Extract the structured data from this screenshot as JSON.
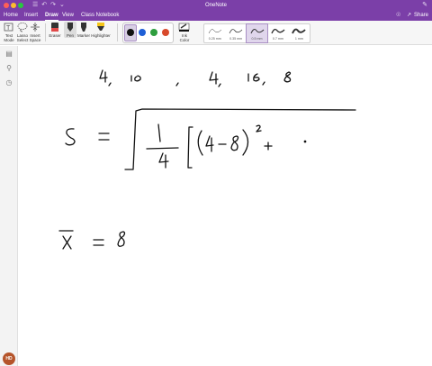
{
  "window": {
    "title": "OneNote"
  },
  "menu": {
    "tabs": [
      "Home",
      "Insert",
      "Draw",
      "View",
      "Class Notebook"
    ],
    "active_tab": "Draw",
    "share_label": "Share"
  },
  "ribbon": {
    "text_mode": [
      "Text",
      "Mode"
    ],
    "lasso_select": [
      "Lasso",
      "Select"
    ],
    "insert_space": [
      "Insert",
      "Space"
    ],
    "eraser": "Eraser",
    "pen": "Pen",
    "marker": "Marker",
    "highlighter": "Highlighter",
    "ink_color": [
      "Ink",
      "Color"
    ],
    "pen_colors": [
      "#111111",
      "#1f5fd6",
      "#2e9e3e",
      "#d84a2c"
    ],
    "thickness": [
      "0.25 mm",
      "0.35 mm",
      "0.5 mm",
      "0.7 mm",
      "1 mm"
    ],
    "selected_thickness": "0.5 mm"
  },
  "leftnav": {
    "icons": [
      "notebooks-icon",
      "search-icon",
      "recent-icon"
    ],
    "avatar_initials": "HD"
  },
  "note": {
    "handwriting_row1": [
      "4,",
      "10,",
      "4,",
      "16,",
      "8"
    ],
    "equation": "S = √(1/4[(4-8)² + ·",
    "mean": "x̄ = 8"
  },
  "colors": {
    "accent": "#7b3fa8",
    "avatar": "#b5542a"
  }
}
